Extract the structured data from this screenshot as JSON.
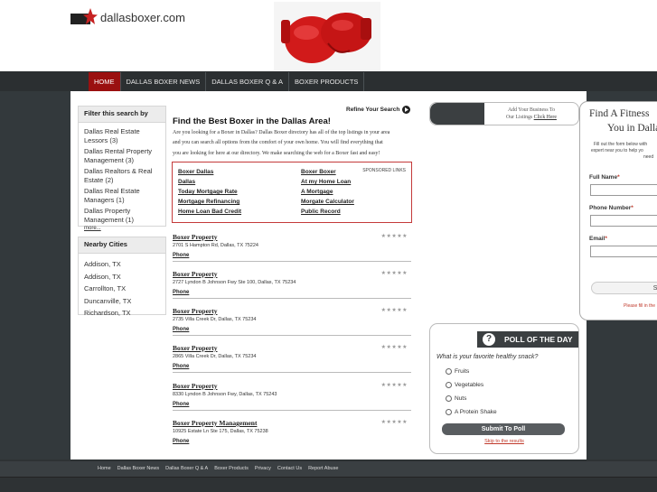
{
  "header": {
    "logo_text": "dallasboxer.com"
  },
  "nav": {
    "items": [
      "HOME",
      "DALLAS BOXER NEWS",
      "DALLAS BOXER Q & A",
      "BOXER PRODUCTS"
    ]
  },
  "filter": {
    "title": "Filter this search by",
    "items": [
      "Dallas Real Estate Lessors (3)",
      "Dallas Rental Property Management (3)",
      "Dallas Realtors & Real Estate (2)",
      "Dallas Real Estate Managers (1)",
      "Dallas Property Management (1)"
    ],
    "more": "more..."
  },
  "cities": {
    "title": "Nearby Cities",
    "items": [
      "Addison, TX",
      "Addison, TX",
      "Carrollton, TX",
      "Duncanville, TX",
      "Richardson, TX"
    ]
  },
  "content": {
    "refine": "Refine Your Search",
    "title": "Find the Best Boxer in the Dallas Area!",
    "intro_lines": [
      "Are you looking for a Boxer in Dallas? Dallas Boxer directory has all of the top listings in your area",
      "and you can search all options from the comfort of your own home. You will find everything that",
      "you are looking for here at our directory. We make searching the web for a Boxer fast and easy!"
    ],
    "sponsored_label": "SPONSORED LINKS",
    "sponsored_left": [
      "Boxer Dallas",
      "Dallas",
      "Today Mortgage Rate",
      "Mortgage Refinancing",
      "Home Loan Bad Credit"
    ],
    "sponsored_right": [
      "Boxer Boxer",
      "At my Home Loan",
      "A Mortgage",
      "Morgate Calculator",
      "Public Record"
    ],
    "stars": "★★★★★",
    "listings": [
      {
        "name": "Boxer Property",
        "address": "2701 S Hampton Rd, Dallas, TX 75224",
        "phone": "Phone"
      },
      {
        "name": "Boxer Property",
        "address": "2727 Lyndon B Johnson Fwy Ste 100, Dallas, TX 75234",
        "phone": "Phone"
      },
      {
        "name": "Boxer Property",
        "address": "2735 Villa Creek Dr, Dallas, TX 75234",
        "phone": "Phone"
      },
      {
        "name": "Boxer Property",
        "address": "2865 Villa Creek Dr, Dallas, TX 75234",
        "phone": "Phone"
      },
      {
        "name": "Boxer Property",
        "address": "8330 Lyndon B Johnson Fwy, Dallas, TX 75243",
        "phone": "Phone"
      },
      {
        "name": "Boxer Property Management",
        "address": "10925 Estate Ln Ste 175, Dallas, TX 75238",
        "phone": "Phone"
      }
    ]
  },
  "addbiz": {
    "line1": "Add Your Business To",
    "line2_prefix": "Our Listings ",
    "link": "Click Here"
  },
  "poll": {
    "title": "POLL OF THE DAY",
    "question": "What is your favorite healthy snack?",
    "options": [
      "Fruits",
      "Vegetables",
      "Nuts",
      "A Protein Shake"
    ],
    "submit": "Submit To Poll",
    "skip": "Skip to the results"
  },
  "fitness": {
    "title1": "Find A Fitness",
    "title2": "You in Dalla",
    "desc1": "Fill out the form below with",
    "desc2": "expert near you to help yo",
    "desc3": "need",
    "full_name": "Full Name",
    "phone": "Phone Number",
    "email": "Email",
    "req": "*",
    "submit": "Subm",
    "note": "Please fill in the"
  },
  "footer": {
    "links": [
      "Home",
      "Dallas Boxer News",
      "Dallas Boxer Q & A",
      "Boxer Products",
      "Privacy",
      "Contact Us",
      "Report Abuse"
    ]
  },
  "colors": {
    "accent_red": "#9a1010",
    "dark_band": "#2b2f31",
    "border_red": "#c43a3a"
  }
}
